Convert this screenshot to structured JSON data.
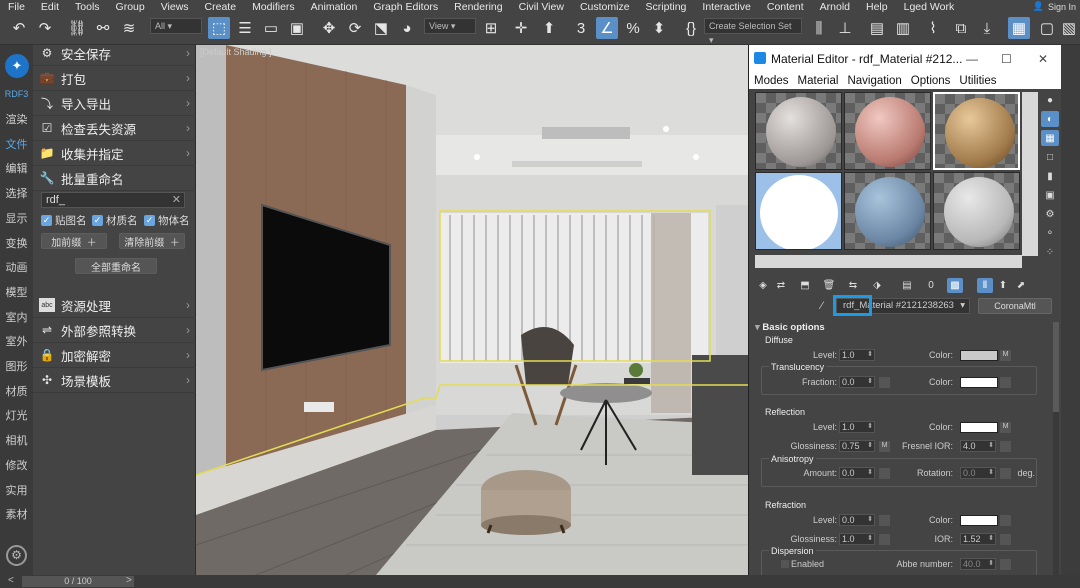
{
  "menu": [
    "File",
    "Edit",
    "Tools",
    "Group",
    "Views",
    "Create",
    "Modifiers",
    "Animation",
    "Graph Editors",
    "Rendering",
    "Civil View",
    "Customize",
    "Scripting",
    "Interactive",
    "Content",
    "Arnold",
    "Help",
    "Lged Work"
  ],
  "account": {
    "label": "Sign In"
  },
  "toolbar": {
    "filter_value": "All",
    "view_value": "View",
    "selection_set_placeholder": "Create Selection Set"
  },
  "left_strip": {
    "logo_label": "RDF3",
    "items": [
      "渲染",
      "文件",
      "编辑",
      "选择",
      "显示",
      "变换",
      "动画",
      "模型",
      "室内",
      "室外",
      "图形",
      "材质",
      "灯光",
      "相机",
      "修改",
      "实用",
      "素材"
    ]
  },
  "panel": {
    "items": [
      {
        "label": "安全保存",
        "icon": "gear-icon"
      },
      {
        "label": "打包",
        "icon": "briefcase-icon"
      },
      {
        "label": "导入导出",
        "icon": "import-icon"
      },
      {
        "label": "检查丢失资源",
        "icon": "check-icon"
      },
      {
        "label": "收集并指定",
        "icon": "folder-icon"
      },
      {
        "label": "批量重命名",
        "icon": "wrench-icon"
      }
    ],
    "rename": {
      "search_value": "rdf_",
      "checkboxes": [
        "贴图名",
        "材质名",
        "物体名"
      ],
      "add_prefix": "加前缀",
      "clear_prefix": "清除前缀",
      "rename_all": "全部重命名"
    },
    "items2": [
      {
        "label": "资源处理",
        "icon": "abc-icon"
      },
      {
        "label": "外部参照转换",
        "icon": "convert-icon"
      },
      {
        "label": "加密解密",
        "icon": "lock-icon"
      },
      {
        "label": "场景模板",
        "icon": "puzzle-icon"
      }
    ]
  },
  "viewport": {
    "label": "[Default Shading ]"
  },
  "timeline": {
    "value": "0 / 100"
  },
  "material_editor": {
    "title": "Material Editor - rdf_Material #212...",
    "menu": [
      "Modes",
      "Material",
      "Navigation",
      "Options",
      "Utilities"
    ],
    "material_name": "rdf_Material #2121238263",
    "material_type": "CoronaMtl",
    "sections": {
      "basic": "Basic options",
      "diffuse": "Diffuse",
      "translucency": "Translucency",
      "reflection": "Reflection",
      "anisotropy": "Anisotropy",
      "refraction": "Refraction",
      "dispersion": "Dispersion"
    },
    "labels": {
      "level": "Level:",
      "color": "Color:",
      "fraction": "Fraction:",
      "glossiness": "Glossiness:",
      "fresnel_ior": "Fresnel IOR:",
      "amount": "Amount:",
      "rotation": "Rotation:",
      "deg": "deg.",
      "ior": "IOR:",
      "enabled": "Enabled",
      "abbe": "Abbe number:",
      "m": "M"
    },
    "values": {
      "diffuse_level": "1.0",
      "translucency_fraction": "0.0",
      "reflection_level": "1.0",
      "reflection_gloss": "0.75",
      "fresnel_ior": "4.0",
      "anisotropy_amount": "0.0",
      "anisotropy_rotation": "0.0",
      "refraction_level": "0.0",
      "refraction_gloss": "1.0",
      "refraction_ior": "1.52",
      "abbe": "40.0"
    },
    "colors": {
      "diffuse": "#c9c9c9",
      "translucency": "#ffffff",
      "reflection": "#ffffff",
      "refraction": "#ffffff"
    }
  },
  "accent": "#5b8fc7"
}
